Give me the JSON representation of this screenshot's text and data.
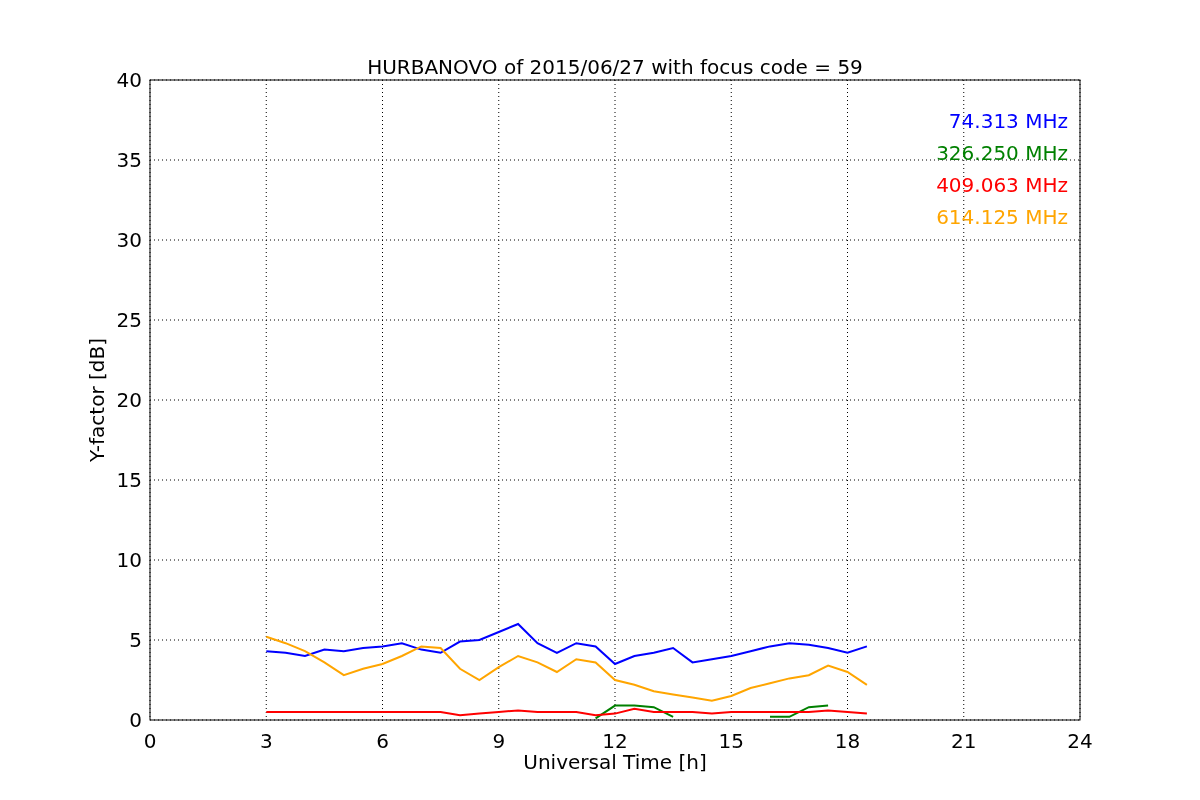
{
  "chart_data": {
    "type": "line",
    "title": "HURBANOVO of 2015/06/27 with focus code = 59",
    "xlabel": "Universal Time [h]",
    "ylabel": "Y-factor [dB]",
    "x": [
      3,
      3.5,
      4,
      4.5,
      5,
      5.5,
      6,
      6.5,
      7,
      7.5,
      8,
      8.5,
      9,
      9.5,
      10,
      10.5,
      11,
      11.5,
      12,
      12.5,
      13,
      13.5,
      14,
      14.5,
      15,
      15.5,
      16,
      16.5,
      17,
      17.5,
      18,
      18.5
    ],
    "series": [
      {
        "name": "74.313 MHz",
        "color": "#0000ff",
        "values": [
          4.3,
          4.2,
          4.0,
          4.4,
          4.3,
          4.5,
          4.6,
          4.8,
          4.4,
          4.2,
          4.9,
          5.0,
          5.5,
          6.0,
          4.8,
          4.2,
          4.8,
          4.6,
          3.5,
          4.0,
          4.2,
          4.5,
          3.6,
          3.8,
          4.0,
          4.3,
          4.6,
          4.8,
          4.7,
          4.5,
          4.2,
          4.6
        ]
      },
      {
        "name": "326.250 MHz",
        "color": "#008000",
        "values": [
          null,
          null,
          null,
          null,
          null,
          null,
          null,
          null,
          null,
          null,
          null,
          null,
          null,
          null,
          null,
          null,
          null,
          0.1,
          0.9,
          0.9,
          0.8,
          0.2,
          null,
          null,
          null,
          null,
          0.2,
          0.2,
          0.8,
          0.9,
          null,
          null
        ]
      },
      {
        "name": "409.063 MHz",
        "color": "#ff0000",
        "values": [
          0.5,
          0.5,
          0.5,
          0.5,
          0.5,
          0.5,
          0.5,
          0.5,
          0.5,
          0.5,
          0.3,
          0.4,
          0.5,
          0.6,
          0.5,
          0.5,
          0.5,
          0.3,
          0.4,
          0.7,
          0.5,
          0.5,
          0.5,
          0.4,
          0.5,
          0.5,
          0.5,
          0.5,
          0.5,
          0.6,
          0.5,
          0.4
        ]
      },
      {
        "name": "614.125 MHz",
        "color": "#ffa500",
        "values": [
          5.2,
          4.8,
          4.3,
          3.6,
          2.8,
          3.2,
          3.5,
          4.0,
          4.6,
          4.5,
          3.2,
          2.5,
          3.3,
          4.0,
          3.6,
          3.0,
          3.8,
          3.6,
          2.5,
          2.2,
          1.8,
          1.6,
          1.4,
          1.2,
          1.5,
          2.0,
          2.3,
          2.6,
          2.8,
          3.4,
          3.0,
          2.2
        ]
      }
    ],
    "grid": true,
    "xlim": [
      0,
      24
    ],
    "ylim": [
      0,
      40
    ],
    "xticks": [
      0,
      3,
      6,
      9,
      12,
      15,
      18,
      21,
      24
    ],
    "yticks": [
      0,
      5,
      10,
      15,
      20,
      25,
      30,
      35,
      40
    ]
  }
}
